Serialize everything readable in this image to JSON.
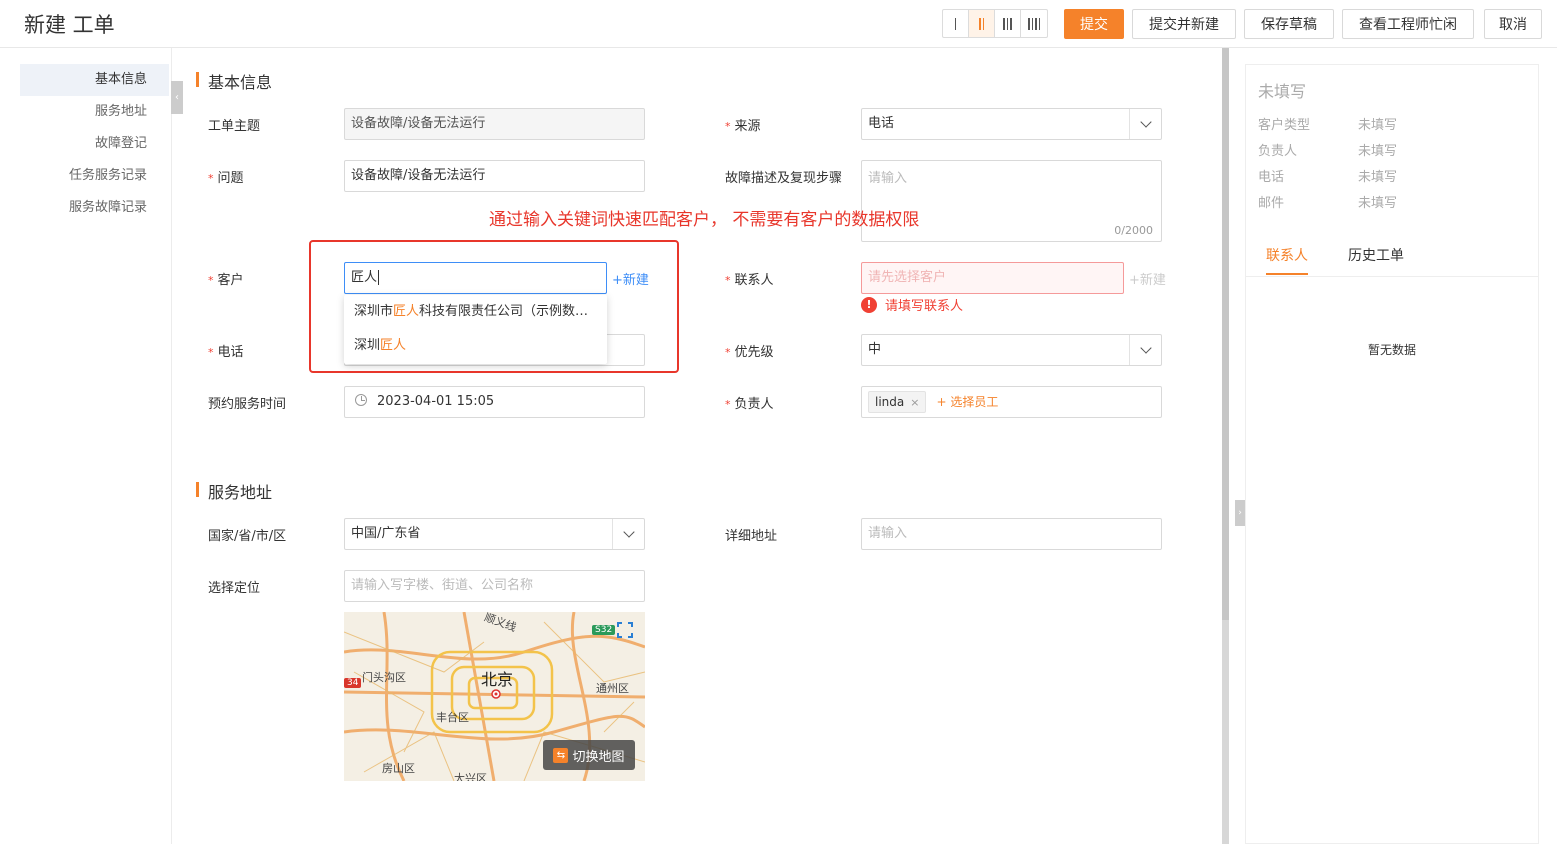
{
  "header": {
    "title": "新建 工单",
    "layout_options": [
      "1-column",
      "2-column",
      "3-column",
      "4-column"
    ],
    "layout_selected": "2-column",
    "buttons": {
      "submit": "提交",
      "submit_new": "提交并新建",
      "save_draft": "保存草稿",
      "engineer_status": "查看工程师忙闲",
      "cancel": "取消"
    }
  },
  "sidebar": {
    "items": [
      {
        "label": "基本信息",
        "active": true
      },
      {
        "label": "服务地址"
      },
      {
        "label": "故障登记"
      },
      {
        "label": "任务服务记录"
      },
      {
        "label": "服务故障记录"
      }
    ]
  },
  "basic": {
    "section_title": "基本信息",
    "subject": {
      "label": "工单主题",
      "value": "设备故障/设备无法运行"
    },
    "source": {
      "label": "来源",
      "value": "电话"
    },
    "issue": {
      "label": "问题",
      "value": "设备故障/设备无法运行"
    },
    "description": {
      "label": "故障描述及复现步骤",
      "placeholder": "请输入",
      "counter": "0/2000"
    },
    "customer": {
      "label": "客户",
      "value": "匠人",
      "new_link": "+新建"
    },
    "contact": {
      "label": "联系人",
      "placeholder": "请先选择客户",
      "new_link": "+新建",
      "error": "请填写联系人"
    },
    "phone": {
      "label": "电话"
    },
    "priority": {
      "label": "优先级",
      "value": "中"
    },
    "appointment": {
      "label": "预约服务时间",
      "value": "2023-04-01 15:05"
    },
    "owner": {
      "label": "负责人",
      "tag": "linda",
      "tag_remove": "×",
      "pick": "+ 选择员工"
    }
  },
  "customer_dropdown": [
    {
      "pre": "深圳市",
      "hl": "匠人",
      "post": "科技有限责任公司（示例数据）"
    },
    {
      "pre": "深圳",
      "hl": "匠人",
      "post": ""
    }
  ],
  "callout": {
    "text": "通过输入关键词快速匹配客户， 不需要有客户的数据权限",
    "color": "#e8362b"
  },
  "address": {
    "section_title": "服务地址",
    "region": {
      "label": "国家/省/市/区",
      "value": "中国/广东省"
    },
    "detail": {
      "label": "详细地址",
      "placeholder": "请输入"
    },
    "location": {
      "label": "选择定位",
      "placeholder": "请输入写字楼、街道、公司名称"
    },
    "map": {
      "city": "北京",
      "districts": [
        "门头沟区",
        "通州区",
        "丰台区",
        "房山区",
        "大兴区",
        "顺义线"
      ],
      "road_shields": [
        "S32",
        "34"
      ],
      "switch_btn": "切换地图"
    }
  },
  "right_panel": {
    "title": "未填写",
    "fields": [
      {
        "label": "客户类型",
        "value": "未填写"
      },
      {
        "label": "负责人",
        "value": "未填写"
      },
      {
        "label": "电话",
        "value": "未填写"
      },
      {
        "label": "邮件",
        "value": "未填写"
      }
    ],
    "tabs": [
      {
        "label": "联系人",
        "active": true
      },
      {
        "label": "历史工单"
      }
    ],
    "empty": "暂无数据"
  },
  "colors": {
    "accent": "#f5822a",
    "link": "#3e8ef7",
    "error": "#f04134"
  },
  "icons": [
    "clock-icon",
    "chevron-down-icon",
    "error-icon",
    "close-icon",
    "fullscreen-icon",
    "swap-icon",
    "chevron-left-icon",
    "chevron-right-icon"
  ]
}
